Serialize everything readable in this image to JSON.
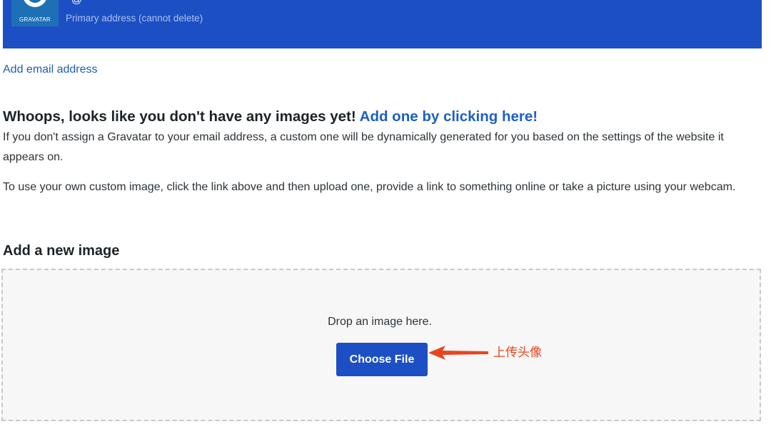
{
  "email_card": {
    "logo_text": "GRAVATAR",
    "email_partial": "@",
    "primary_note": "Primary address (cannot delete)"
  },
  "add_email_link": "Add email address",
  "no_images": {
    "heading": "Whoops, looks like you don't have any images yet!",
    "heading_link": "Add one by clicking here!",
    "para1": "If you don't assign a Gravatar to your email address, a custom one will be dynamically generated for you based on the settings of the website it appears on.",
    "para2": "To use your own custom image, click the link above and then upload one, provide a link to something online or take a picture using your webcam."
  },
  "upload": {
    "heading": "Add a new image",
    "drop_text": "Drop an image here.",
    "button_label": "Choose File",
    "annotation": "上传头像"
  },
  "colors": {
    "banner": "#1d4fc4",
    "link": "#1d5fc4",
    "button": "#1d4fc4",
    "annotation": "#e8451f"
  },
  "icons": {
    "logo": "gravatar-logo-icon",
    "arrow": "arrow-left-icon"
  }
}
